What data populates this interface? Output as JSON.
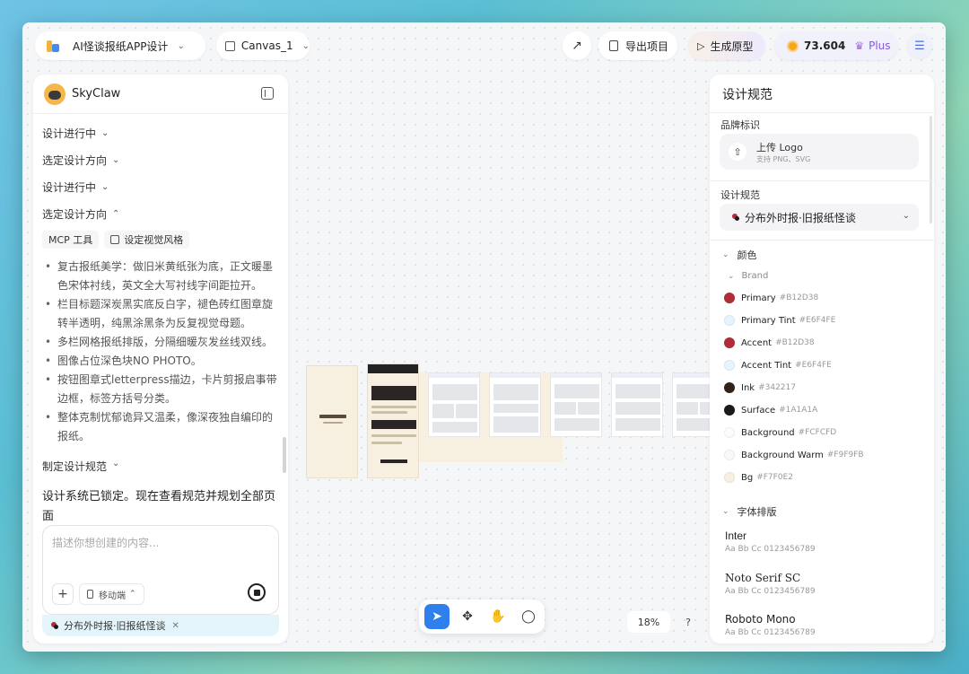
{
  "topbar": {
    "project_name": "AI怪谈报纸APP设计",
    "canvas_name": "Canvas_1",
    "export_label": "导出项目",
    "prototype_label": "生成原型",
    "credits": "73.604",
    "plan": "Plus"
  },
  "assistant": {
    "name": "SkyClaw",
    "steps": [
      {
        "label": "设计进行中"
      },
      {
        "label": "选定设计方向"
      },
      {
        "label": "设计进行中"
      },
      {
        "label": "选定设计方向"
      }
    ],
    "tools": [
      "MCP 工具",
      "设定视觉风格"
    ],
    "bullets": [
      "复古报纸美学：做旧米黄纸张为底，正文暖墨色宋体衬线，英文全大写衬线字间距拉开。",
      "栏目标题深炭黑实底反白字，褪色砖红图章旋转半透明，纯黑涂黑条为反复视觉母题。",
      "多栏网格报纸排版，分隔细暖灰发丝线双线。",
      "图像占位深色块NO PHOTO。",
      "按钮图章式letterpress描边，卡片剪报启事带边框，标签方括号分类。",
      "整体克制忧郁诡异又温柔，像深夜独自编印的报纸。"
    ],
    "last_step": "制定设计规范",
    "status_message": "设计系统已锁定。现在查看规范并规划全部页面",
    "composer_placeholder": "描述你想创建的内容...",
    "device": "移动端",
    "context_tag": "分布外时报·旧报纸怪谈"
  },
  "canvas": {
    "zoom": "18%",
    "help": "?"
  },
  "spec": {
    "title": "设计规范",
    "brand_label": "品牌标识",
    "upload_title": "上传 Logo",
    "upload_sub": "支持 PNG、SVG",
    "spec_label": "设计规范",
    "selected_style": "分布外时报·旧报纸怪谈",
    "colors_head": "颜色",
    "brand_head": "Brand",
    "colors": [
      {
        "name": "Primary",
        "hex": "#B12D38"
      },
      {
        "name": "Primary Tint",
        "hex": "#E6F4FE"
      },
      {
        "name": "Accent",
        "hex": "#B12D38"
      },
      {
        "name": "Accent Tint",
        "hex": "#E6F4FE"
      },
      {
        "name": "Ink",
        "hex": "#342217"
      },
      {
        "name": "Surface",
        "hex": "#1A1A1A"
      },
      {
        "name": "Background",
        "hex": "#FCFCFD"
      },
      {
        "name": "Background Warm",
        "hex": "#F9F9FB"
      },
      {
        "name": "Bg",
        "hex": "#F7F0E2"
      }
    ],
    "typography_head": "字体排版",
    "fonts": [
      {
        "name": "Inter",
        "sample": "Aa Bb Cc 0123456789"
      },
      {
        "name": "Noto Serif SC",
        "sample": "Aa Bb Cc 0123456789"
      },
      {
        "name": "Roboto Mono",
        "sample": "Aa Bb Cc 0123456789"
      }
    ]
  }
}
